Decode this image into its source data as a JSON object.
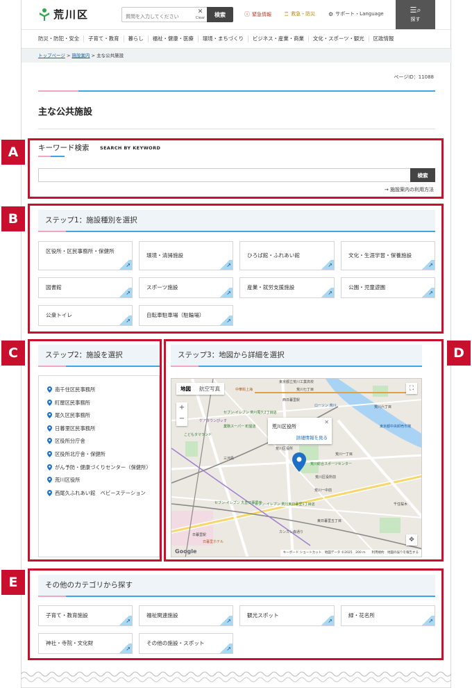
{
  "header": {
    "logo_text": "荒川区",
    "search_placeholder": "質問を入力してください",
    "clear_label": "Clear",
    "search_button": "検索",
    "emergency": "緊急情報",
    "disaster": "救急・防災",
    "support": "サポート・Language",
    "menu_label": "探す"
  },
  "nav": [
    "防災・防犯・安全",
    "子育て・教育",
    "暮らし",
    "福祉・健康・医療",
    "環境・まちづくり",
    "ビジネス・産業・商業",
    "文化・スポーツ・観光",
    "区政情報"
  ],
  "breadcrumb": {
    "home": "トップページ",
    "sep": " > ",
    "guide": "施設案内",
    "current": "主な公共施設"
  },
  "page_id": "ページID：11088",
  "page_title": "主な公共施設",
  "keyword": {
    "title": "キーワード検索",
    "subtitle": "SEARCH BY KEYWORD",
    "button": "検索",
    "help": "→ 施設案内の利用方法"
  },
  "step1": {
    "title": "ステップ1：施設種別を選択",
    "tiles": [
      "区役所・区民事務所・保健所",
      "環境・清掃施設",
      "ひろば館・ふれあい館",
      "文化・生涯学習・保養施設",
      "図書館",
      "スポーツ施設",
      "産業・就労支援施設",
      "公園・児童遊園",
      "公衆トイレ",
      "自転車駐車場（駐輪場）"
    ]
  },
  "step2": {
    "title": "ステップ2：施設を選択",
    "items": [
      "南千住区民事務所",
      "町屋区民事務所",
      "尾久区民事務所",
      "日暮里区民事務所",
      "区役所分庁舎",
      "区役所北庁舎・保健所",
      "がん予防・健康づくりセンター（保健所）",
      "荒川区役所",
      "西尾久ふれあい館　ベビーステーション"
    ]
  },
  "step3": {
    "title": "ステップ3：地図から詳細を選択",
    "tab_map": "地図",
    "tab_satellite": "航空写真",
    "info_name": "荒川区役所",
    "info_link": "詳細情報を見る",
    "google": "Google",
    "attribution": "キーボード ショートカット　地図データ ©2025　200 m　　利用規約　地図の誤りを報告する",
    "map_labels": [
      "東京都立荒川工業高校",
      "中華街上海",
      "西日暮里駅",
      "荒川七丁目",
      "ローソン 荒川",
      "荒川六丁目",
      "セブン-イレブン 荒川尾久2丁目店",
      "業務スーパー 町屋店",
      "ケアタウンぴぃす",
      "こどもタマランド",
      "荒川区役所",
      "三河島",
      "荒川一丁目",
      "荒川総合スポーツセンター",
      "荒川区役所前",
      "セブン-イレブン 荒川東日暮里1丁目店",
      "東日暮里五丁目",
      "カンカン森通り",
      "日暮里駅",
      "東京都中央卸売市場",
      "千住桜木",
      "荒川一中前",
      "セブン-イレブン 丸善日暮里店",
      "日暮里ホテル"
    ]
  },
  "other": {
    "title": "その他のカテゴリから探す",
    "tiles": [
      "子育て・教育施設",
      "福祉関連施設",
      "観光スポット",
      "緑・花名所",
      "神社・寺院・文化財",
      "その他の施設・スポット"
    ]
  },
  "annotations": [
    "A",
    "B",
    "C",
    "D",
    "E"
  ],
  "colors": {
    "accent_blue": "#3ba6e3",
    "accent_pink": "#f0a5c3",
    "annotation_red": "#c8102e",
    "step_bg": "#eef4f7"
  }
}
